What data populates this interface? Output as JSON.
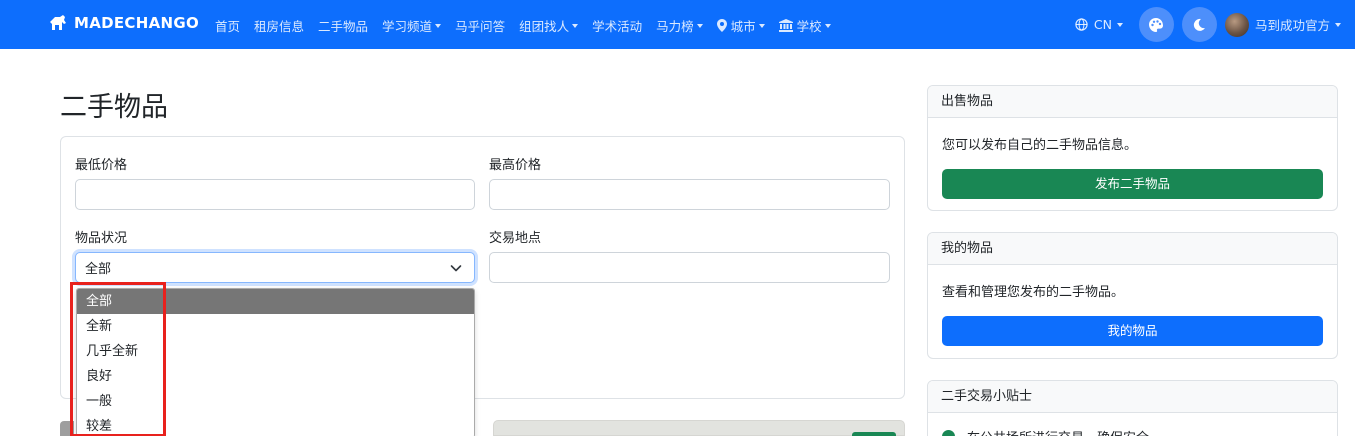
{
  "navbar": {
    "brand": "MADECHANGO",
    "links": [
      {
        "label": "首页",
        "has_caret": false
      },
      {
        "label": "租房信息",
        "has_caret": false
      },
      {
        "label": "二手物品",
        "has_caret": false
      },
      {
        "label": "学习频道",
        "has_caret": true
      },
      {
        "label": "马乎问答",
        "has_caret": false
      },
      {
        "label": "组团找人",
        "has_caret": true
      },
      {
        "label": "学术活动",
        "has_caret": false
      },
      {
        "label": "马力榜",
        "has_caret": true
      },
      {
        "label": "城市",
        "has_caret": true,
        "icon": "map-pin-icon"
      },
      {
        "label": "学校",
        "has_caret": true,
        "icon": "university-icon"
      }
    ],
    "lang": "CN",
    "user_name": "马到成功官方",
    "accent": "#0d6efd"
  },
  "main": {
    "title": "二手物品",
    "filters": {
      "min_price_label": "最低价格",
      "min_price_value": "",
      "max_price_label": "最高价格",
      "max_price_value": "",
      "condition_label": "物品状况",
      "condition_value": "全部",
      "location_label": "交易地点",
      "location_value": ""
    },
    "condition_options": [
      "全部",
      "全新",
      "几乎全新",
      "良好",
      "一般",
      "较差"
    ],
    "selected_option": "全部"
  },
  "sidebar": {
    "sell": {
      "title": "出售物品",
      "text": "您可以发布自己的二手物品信息。",
      "button": "发布二手物品",
      "button_color": "#198754"
    },
    "mine": {
      "title": "我的物品",
      "text": "查看和管理您发布的二手物品。",
      "button": "我的物品",
      "button_color": "#0d6efd"
    },
    "tips": {
      "title": "二手交易小贴士",
      "first_tip": "在公共场所进行交易，确保安全"
    }
  },
  "colors": {
    "highlight": "#e8211d",
    "selected_option_bg": "#767676"
  }
}
